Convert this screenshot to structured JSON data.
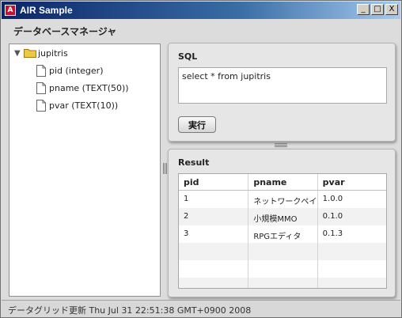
{
  "window": {
    "title": "AIR Sample",
    "app_icon_glyph": "A",
    "minimize_glyph": "_",
    "maximize_glyph": "□",
    "close_glyph": "X"
  },
  "header": {
    "title": "データベースマネージャ"
  },
  "tree": {
    "root": {
      "label": "jupitris",
      "icon": "folder-icon",
      "expanded": true
    },
    "children": [
      {
        "label": "pid (integer)",
        "icon": "file-icon"
      },
      {
        "label": "pname (TEXT(50))",
        "icon": "file-icon"
      },
      {
        "label": "pvar (TEXT(10))",
        "icon": "file-icon"
      }
    ]
  },
  "sql_panel": {
    "title": "SQL",
    "query": "select * from jupitris",
    "execute_label": "実行"
  },
  "result_panel": {
    "title": "Result",
    "columns": [
      "pid",
      "pname",
      "pvar"
    ],
    "rows": [
      [
        "1",
        "ネットワークペイント",
        "1.0.0"
      ],
      [
        "2",
        "小規模MMO",
        "0.1.0"
      ],
      [
        "3",
        "RPGエディタ",
        "0.1.3"
      ]
    ]
  },
  "status": {
    "text": "データグリッド更新 Thu Jul 31 22:51:38 GMT+0900 2008"
  },
  "colors": {
    "title_bar": "#0a246a",
    "folder": "#f0c840"
  }
}
